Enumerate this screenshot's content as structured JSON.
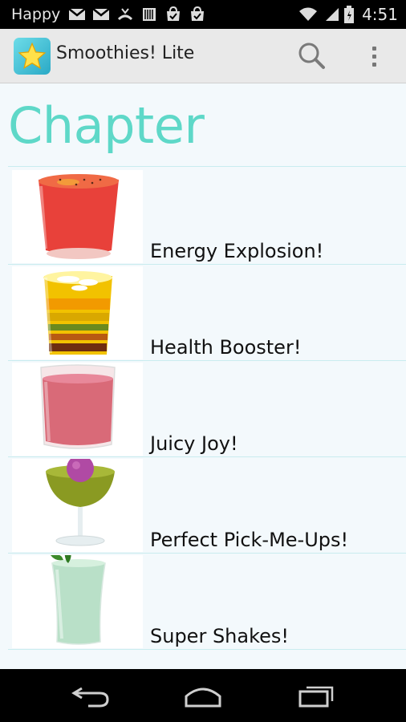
{
  "status_bar": {
    "carrier": "Happy",
    "time": "4:51",
    "notification_icons": [
      "gmail-icon",
      "gmail-icon",
      "missed-call-icon",
      "barcode-icon",
      "play-store-icon",
      "play-store-icon"
    ],
    "system_icons": [
      "wifi-icon",
      "signal-icon",
      "battery-icon"
    ]
  },
  "action_bar": {
    "title": "Smoothies! Lite",
    "icons": [
      "app-star-icon",
      "search-icon",
      "overflow-menu-icon"
    ]
  },
  "main": {
    "heading": "Chapter",
    "chapters": [
      {
        "label": "Energy Explosion!",
        "image": "red-smoothie-image"
      },
      {
        "label": "Health Booster!",
        "image": "layered-smoothie-image"
      },
      {
        "label": "Juicy Joy!",
        "image": "pink-smoothie-image"
      },
      {
        "label": "Perfect Pick-Me-Ups!",
        "image": "green-cocktail-image"
      },
      {
        "label": "Super Shakes!",
        "image": "mint-shake-image"
      }
    ]
  },
  "nav_bar": {
    "icons": [
      "back-icon",
      "home-icon",
      "recent-apps-icon"
    ]
  },
  "colors": {
    "heading": "#5ed8c8",
    "action_bar": "#e9e9e9",
    "background": "#f3f9fc",
    "divider": "#c9ecef"
  }
}
